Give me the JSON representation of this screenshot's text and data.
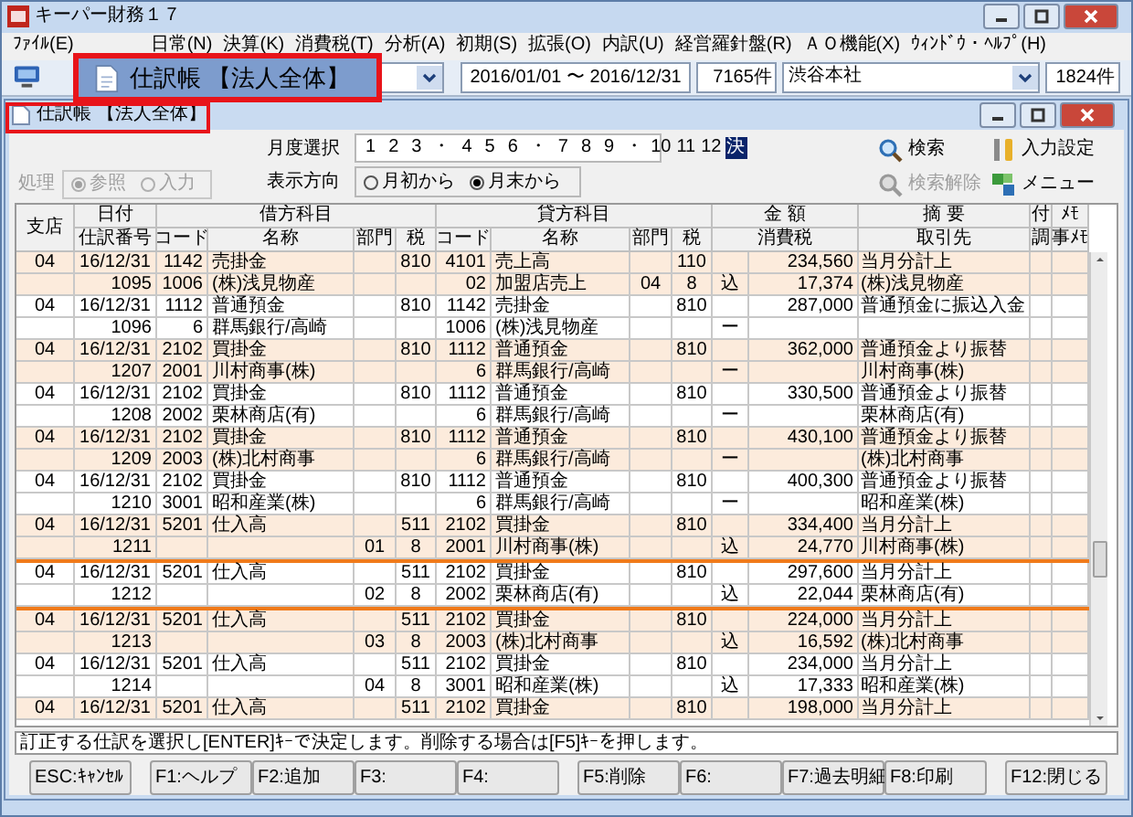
{
  "window": {
    "title": "キーパー財務１７"
  },
  "menu": [
    "ﾌｧｲﾙ(E)",
    "日常(N)",
    "決算(K)",
    "消費税(T)",
    "分析(A)",
    "初期(S)",
    "拡張(O)",
    "内訳(U)",
    "経営羅針盤(R)",
    "ＡＯ機能(X)",
    "ｳｨﾝﾄﾞｳ・ﾍﾙﾌﾟ(H)"
  ],
  "toolbar": {
    "period": "2016/01/01 〜 2016/12/31",
    "count": "7165件",
    "office": "渋谷本社",
    "office_count": "1824件"
  },
  "callout": {
    "title": "仕訳帳 【法人全体】"
  },
  "journal_window": {
    "title": "仕訳帳 【法人全体】"
  },
  "mode": {
    "label": "処理",
    "disabled": true,
    "options": [
      {
        "label": "参照",
        "selected": true
      },
      {
        "label": "入力",
        "selected": false
      }
    ]
  },
  "month_select": {
    "label": "月度選択",
    "items": [
      {
        "kind": "month",
        "label": "1",
        "selected": false
      },
      {
        "kind": "month",
        "label": "2",
        "selected": false
      },
      {
        "kind": "month",
        "label": "3",
        "selected": false
      },
      {
        "kind": "sep",
        "label": "・"
      },
      {
        "kind": "month",
        "label": "4",
        "selected": false
      },
      {
        "kind": "month",
        "label": "5",
        "selected": false
      },
      {
        "kind": "month",
        "label": "6",
        "selected": false
      },
      {
        "kind": "sep",
        "label": "・"
      },
      {
        "kind": "month",
        "label": "7",
        "selected": false
      },
      {
        "kind": "month",
        "label": "8",
        "selected": false
      },
      {
        "kind": "month",
        "label": "9",
        "selected": false
      },
      {
        "kind": "sep",
        "label": "・"
      },
      {
        "kind": "month",
        "label": "10",
        "selected": false
      },
      {
        "kind": "month",
        "label": "11",
        "selected": false
      },
      {
        "kind": "month",
        "label": "12",
        "selected": false
      },
      {
        "kind": "month",
        "label": "決",
        "selected": true
      }
    ]
  },
  "direction": {
    "label": "表示方向",
    "options": [
      {
        "label": "月初から",
        "selected": false
      },
      {
        "label": "月末から",
        "selected": true
      }
    ]
  },
  "actions": [
    {
      "kind": "search",
      "label": "検索",
      "disabled": false
    },
    {
      "kind": "settings",
      "label": "入力設定",
      "disabled": false
    },
    {
      "kind": "clear",
      "label": "検索解除",
      "disabled": true
    },
    {
      "kind": "menu",
      "label": "メニュー",
      "disabled": false
    }
  ],
  "table": {
    "header_top": [
      "支店",
      "日付",
      "借方科目",
      "貸方科目",
      "金 額",
      "摘 要",
      "付",
      "ﾒﾓ"
    ],
    "header_sub": [
      "仕訳番号",
      "コード",
      "名称",
      "部門",
      "税",
      "コード",
      "名称",
      "部門",
      "税",
      "消費税",
      "取引先",
      "調",
      "事ﾒﾓ"
    ],
    "entries": [
      {
        "shaded": true,
        "selected": false,
        "lines": [
          {
            "branch": "04",
            "date": "16/12/31",
            "debit_code": "1142",
            "debit_name": "売掛金",
            "debit_tax": "810",
            "credit_code": "4101",
            "credit_name": "売上高",
            "credit_tax": "110",
            "amount": "234,560",
            "summary": "当月分計上"
          },
          {
            "number": "1095",
            "debit_code": "1006",
            "debit_name": "(株)浅見物産",
            "credit_code": "02",
            "credit_name": "加盟店売上",
            "credit_dept": "04",
            "credit_tax": "8",
            "tax_mark": "込",
            "amount": "17,374",
            "summary": "(株)浅見物産"
          }
        ]
      },
      {
        "shaded": false,
        "selected": false,
        "lines": [
          {
            "branch": "04",
            "date": "16/12/31",
            "debit_code": "1112",
            "debit_name": "普通預金",
            "debit_tax": "810",
            "credit_code": "1142",
            "credit_name": "売掛金",
            "credit_tax": "810",
            "amount": "287,000",
            "summary": "普通預金に振込入金"
          },
          {
            "number": "1096",
            "debit_code": "6",
            "debit_name": "群馬銀行/高崎",
            "credit_code": "1006",
            "credit_name": "(株)浅見物産",
            "tax_mark": "ー"
          }
        ]
      },
      {
        "shaded": true,
        "selected": false,
        "lines": [
          {
            "branch": "04",
            "date": "16/12/31",
            "debit_code": "2102",
            "debit_name": "買掛金",
            "debit_tax": "810",
            "credit_code": "1112",
            "credit_name": "普通預金",
            "credit_tax": "810",
            "amount": "362,000",
            "summary": "普通預金より振替"
          },
          {
            "number": "1207",
            "debit_code": "2001",
            "debit_name": "川村商事(株)",
            "credit_code": "6",
            "credit_name": "群馬銀行/高崎",
            "tax_mark": "ー",
            "summary": "川村商事(株)"
          }
        ]
      },
      {
        "shaded": false,
        "selected": false,
        "lines": [
          {
            "branch": "04",
            "date": "16/12/31",
            "debit_code": "2102",
            "debit_name": "買掛金",
            "debit_tax": "810",
            "credit_code": "1112",
            "credit_name": "普通預金",
            "credit_tax": "810",
            "amount": "330,500",
            "summary": "普通預金より振替"
          },
          {
            "number": "1208",
            "debit_code": "2002",
            "debit_name": "栗林商店(有)",
            "credit_code": "6",
            "credit_name": "群馬銀行/高崎",
            "tax_mark": "ー",
            "summary": "栗林商店(有)"
          }
        ]
      },
      {
        "shaded": true,
        "selected": false,
        "lines": [
          {
            "branch": "04",
            "date": "16/12/31",
            "debit_code": "2102",
            "debit_name": "買掛金",
            "debit_tax": "810",
            "credit_code": "1112",
            "credit_name": "普通預金",
            "credit_tax": "810",
            "amount": "430,100",
            "summary": "普通預金より振替"
          },
          {
            "number": "1209",
            "debit_code": "2003",
            "debit_name": "(株)北村商事",
            "credit_code": "6",
            "credit_name": "群馬銀行/高崎",
            "tax_mark": "ー",
            "summary": "(株)北村商事"
          }
        ]
      },
      {
        "shaded": false,
        "selected": false,
        "lines": [
          {
            "branch": "04",
            "date": "16/12/31",
            "debit_code": "2102",
            "debit_name": "買掛金",
            "debit_tax": "810",
            "credit_code": "1112",
            "credit_name": "普通預金",
            "credit_tax": "810",
            "amount": "400,300",
            "summary": "普通預金より振替"
          },
          {
            "number": "1210",
            "debit_code": "3001",
            "debit_name": "昭和産業(株)",
            "credit_code": "6",
            "credit_name": "群馬銀行/高崎",
            "tax_mark": "ー",
            "summary": "昭和産業(株)"
          }
        ]
      },
      {
        "shaded": true,
        "selected": false,
        "lines": [
          {
            "branch": "04",
            "date": "16/12/31",
            "debit_code": "5201",
            "debit_name": "仕入高",
            "debit_tax": "511",
            "credit_code": "2102",
            "credit_name": "買掛金",
            "credit_tax": "810",
            "amount": "334,400",
            "summary": "当月分計上"
          },
          {
            "number": "1211",
            "debit_dept": "01",
            "debit_tax": "8",
            "credit_code": "2001",
            "credit_name": "川村商事(株)",
            "tax_mark": "込",
            "amount": "24,770",
            "summary": "川村商事(株)"
          }
        ]
      },
      {
        "shaded": false,
        "selected": true,
        "lines": [
          {
            "branch": "04",
            "date": "16/12/31",
            "debit_code": "5201",
            "debit_name": "仕入高",
            "debit_tax": "511",
            "credit_code": "2102",
            "credit_name": "買掛金",
            "credit_tax": "810",
            "amount": "297,600",
            "summary": "当月分計上"
          },
          {
            "number": "1212",
            "debit_dept": "02",
            "debit_tax": "8",
            "credit_code": "2002",
            "credit_name": "栗林商店(有)",
            "tax_mark": "込",
            "amount": "22,044",
            "summary": "栗林商店(有)"
          }
        ]
      },
      {
        "shaded": true,
        "selected": false,
        "lines": [
          {
            "branch": "04",
            "date": "16/12/31",
            "debit_code": "5201",
            "debit_name": "仕入高",
            "debit_tax": "511",
            "credit_code": "2102",
            "credit_name": "買掛金",
            "credit_tax": "810",
            "amount": "224,000",
            "summary": "当月分計上"
          },
          {
            "number": "1213",
            "debit_dept": "03",
            "debit_tax": "8",
            "credit_code": "2003",
            "credit_name": "(株)北村商事",
            "tax_mark": "込",
            "amount": "16,592",
            "summary": "(株)北村商事"
          }
        ]
      },
      {
        "shaded": false,
        "selected": false,
        "lines": [
          {
            "branch": "04",
            "date": "16/12/31",
            "debit_code": "5201",
            "debit_name": "仕入高",
            "debit_tax": "511",
            "credit_code": "2102",
            "credit_name": "買掛金",
            "credit_tax": "810",
            "amount": "234,000",
            "summary": "当月分計上"
          },
          {
            "number": "1214",
            "debit_dept": "04",
            "debit_tax": "8",
            "credit_code": "3001",
            "credit_name": "昭和産業(株)",
            "tax_mark": "込",
            "amount": "17,333",
            "summary": "昭和産業(株)"
          }
        ]
      },
      {
        "shaded": true,
        "selected": false,
        "lines": [
          {
            "branch": "04",
            "date": "16/12/31",
            "debit_code": "5201",
            "debit_name": "仕入高",
            "debit_tax": "511",
            "credit_code": "2102",
            "credit_name": "買掛金",
            "credit_tax": "810",
            "amount": "198,000",
            "summary": "当月分計上"
          }
        ]
      }
    ]
  },
  "message": "訂正する仕訳を選択し[ENTER]ｷｰで決定します。削除する場合は[F5]ｷｰを押します。",
  "function_keys": [
    "ESC:ｷｬﾝｾﾙ",
    "F1:ヘルプ",
    "F2:追加",
    "F3:",
    "F4:",
    "F5:削除",
    "F6:",
    "F7:過去明細",
    "F8:印刷",
    "F12:閉じる"
  ]
}
